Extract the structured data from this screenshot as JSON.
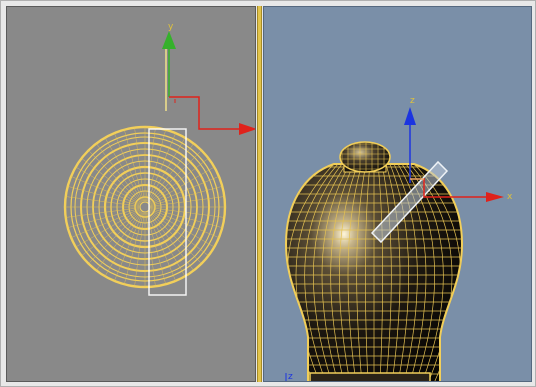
{
  "viewports": {
    "top": {
      "axis_labels": {
        "y": "y"
      },
      "colors": {
        "background": "#898989",
        "wire": "#f2cf5a",
        "y_axis": "#35b12b",
        "x_axis": "#e0221b"
      }
    },
    "front": {
      "axis_labels": {
        "z": "z",
        "x": "x",
        "corner_z": "z"
      },
      "colors": {
        "background": "#7a8fa8",
        "wire": "#f2cf5a",
        "z_axis": "#1c34e0",
        "x_axis": "#e0221b"
      }
    }
  },
  "divider": {
    "color": "#e2c44c"
  }
}
